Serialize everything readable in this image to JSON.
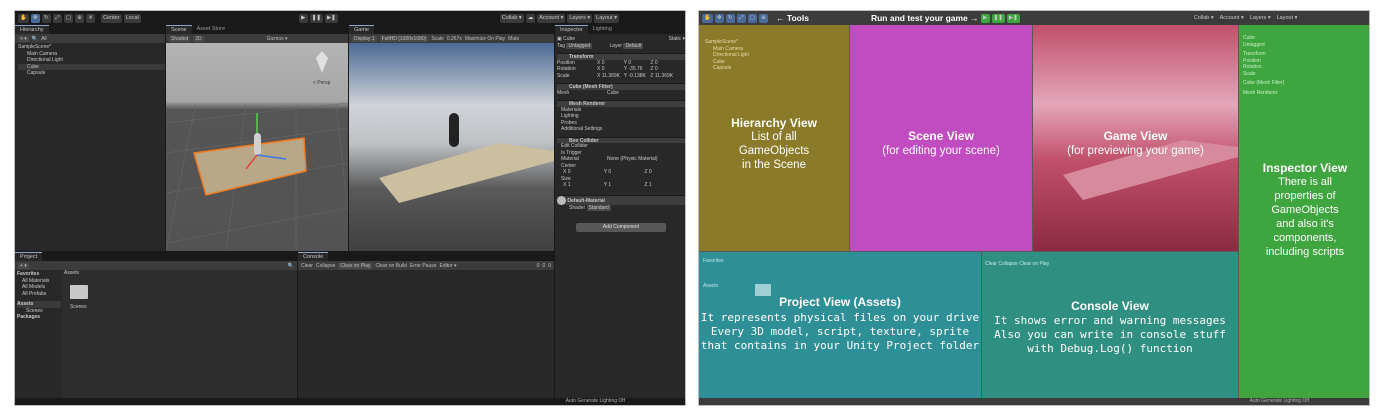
{
  "toolbar": {
    "pivot": "Center",
    "space": "Local",
    "collab": "Collab ▾",
    "account": "Account ▾",
    "layers": "Layers ▾",
    "layout": "Layout ▾"
  },
  "hierarchy": {
    "tab": "Hierarchy",
    "search_label": "All",
    "scene": "SampleScene*",
    "items": [
      "Main Camera",
      "Directional Light",
      "Cube",
      "Capsule"
    ]
  },
  "scene_view": {
    "tabs": [
      "Scene",
      "Asset Store"
    ],
    "toolbar": [
      "Shaded",
      "2D",
      "Gizmos ▾",
      "All"
    ],
    "persp": "< Persp"
  },
  "game_view": {
    "tab": "Game",
    "toolbar": [
      "Display 1",
      "FullHD (1920x1080)",
      "Scale",
      "0.267x",
      "Maximize On Play",
      "Mute"
    ]
  },
  "inspector": {
    "tabs": [
      "Inspector",
      "Lighting"
    ],
    "object_name": "Cube",
    "static": "Static ▾",
    "tag_label": "Tag",
    "tag_value": "Untagged",
    "layer_label": "Layer",
    "layer_value": "Default",
    "transform": "Transform",
    "position": {
      "label": "Position",
      "x": "0",
      "y": "0",
      "z": "0"
    },
    "rotation": {
      "label": "Rotation",
      "x": "0",
      "y": "-35.76",
      "z": "0"
    },
    "scale": {
      "label": "Scale",
      "x": "11.369K",
      "y": "-0.138K",
      "z": "11.369K"
    },
    "mesh_filter": "Cube (Mesh Filter)",
    "mesh_label": "Mesh",
    "mesh_value": "Cube",
    "mesh_renderer": "Mesh Renderer",
    "renderer_sections": [
      "Materials",
      "Lighting",
      "Probes",
      "Additional Settings"
    ],
    "box_collider": "Box Collider",
    "collider_rows": [
      "Edit Collider",
      "Is Trigger",
      "Material",
      "Center",
      "Size"
    ],
    "collider_material": "None (Physic Material)",
    "center": {
      "x": "0",
      "y": "0",
      "z": "0"
    },
    "size": {
      "x": "1",
      "y": "1",
      "z": "1"
    },
    "default_material": "Default-Material",
    "shader_label": "Shader",
    "shader_value": "Standard",
    "add_component": "Add Component"
  },
  "project": {
    "tab": "Project",
    "tree": [
      "Favorites",
      "All Materials",
      "All Models",
      "All Prefabs",
      "Assets",
      "Scenes",
      "Packages"
    ],
    "breadcrumb": "Assets",
    "folder": "Scenes"
  },
  "console": {
    "tab": "Console",
    "buttons": [
      "Clear",
      "Collapse",
      "Clear on Play",
      "Clear on Build",
      "Error Pause",
      "Editor ▾"
    ],
    "counts": [
      "0",
      "0",
      "0"
    ]
  },
  "status": "Auto Generate Lighting Off",
  "overlay": {
    "tools": "← Tools",
    "run": "Run and test your game →",
    "hierarchy_title": "Hierarchy View",
    "hierarchy_body": "List of all\nGameObjects\nin the Scene",
    "scene_title": "Scene View",
    "scene_body": "(for editing your scene)",
    "game_title": "Game View",
    "game_body": "(for previewing your game)",
    "inspector_title": "Inspector View",
    "inspector_body": "There is all\nproperties of\nGameObjects\nand also it's\ncomponents,\nincluding scripts",
    "project_title": "Project View (Assets)",
    "project_body": "It represents physical files on your drive\nEvery 3D model, script, texture, sprite\nthat contains in your Unity Project folder",
    "console_title": "Console View",
    "console_body": "It shows error and warning messages\nAlso you can write in console stuff\nwith Debug.Log() function"
  },
  "colors": {
    "hierarchy_tint": "#8a7a2a",
    "scene_tint": "#c04cc0",
    "game_tint": "#c0506a",
    "inspector_tint": "#3fa63f",
    "project_tint": "#2f8f96",
    "console_tint": "#2f8f80"
  }
}
